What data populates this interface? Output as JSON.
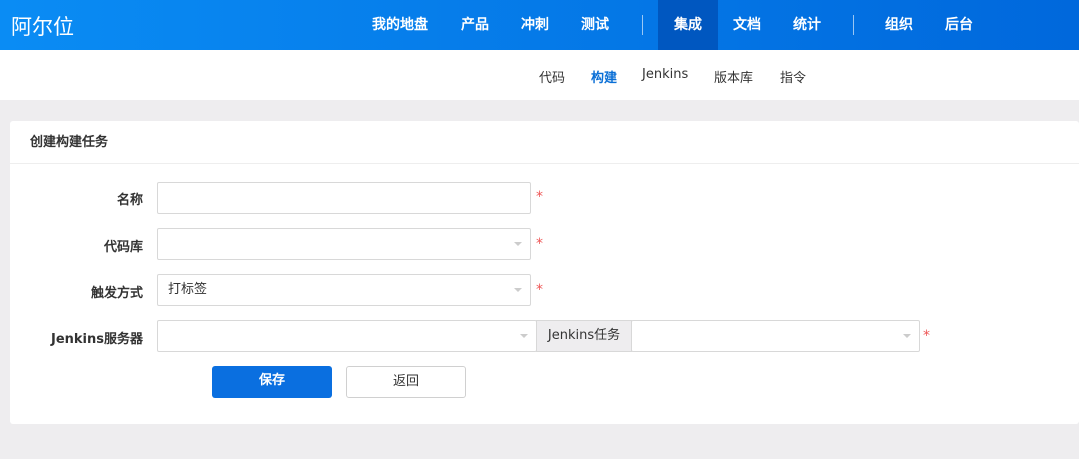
{
  "app": {
    "logo": "阿尔位"
  },
  "nav": [
    "我的地盘",
    "产品",
    "冲刺",
    "测试",
    "集成",
    "文档",
    "统计",
    "组织",
    "后台"
  ],
  "subnav": [
    "代码",
    "构建",
    "Jenkins",
    "版本库",
    "指令"
  ],
  "panel": {
    "title": "创建构建任务"
  },
  "form": {
    "name_label": "名称",
    "name_value": "",
    "repo_label": "代码库",
    "trigger_label": "触发方式",
    "trigger_value": "打标签",
    "jenkins_label": "Jenkins服务器",
    "jenkins_job_label": "Jenkins任务",
    "required": "*"
  },
  "buttons": {
    "save": "保存",
    "back": "返回"
  }
}
